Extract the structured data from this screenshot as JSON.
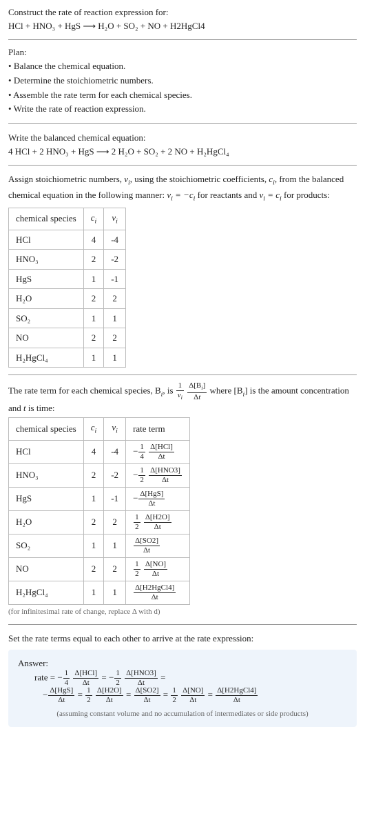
{
  "intro": {
    "line1": "Construct the rate of reaction expression for:",
    "line2": "HCl + HNO₃ + HgS ⟶ H₂O + SO₂ + NO + H2HgCl4"
  },
  "plan": {
    "heading": "Plan:",
    "items": [
      "Balance the chemical equation.",
      "Determine the stoichiometric numbers.",
      "Assemble the rate term for each chemical species.",
      "Write the rate of reaction expression."
    ]
  },
  "balanced": {
    "heading": "Write the balanced chemical equation:",
    "equation": "4 HCl + 2 HNO₃ + HgS ⟶ 2 H₂O + SO₂ + 2 NO + H₂HgCl₄"
  },
  "assign_text_a": "Assign stoichiometric numbers, ",
  "assign_text_b": ", using the stoichiometric coefficients, ",
  "assign_text_c": ", from the balanced chemical equation in the following manner: ",
  "assign_text_d": " for reactants and ",
  "assign_text_e": " for products:",
  "table1": {
    "headers": [
      "chemical species",
      "cᵢ",
      "νᵢ"
    ],
    "rows": [
      [
        "HCl",
        "4",
        "-4"
      ],
      [
        "HNO₃",
        "2",
        "-2"
      ],
      [
        "HgS",
        "1",
        "-1"
      ],
      [
        "H₂O",
        "2",
        "2"
      ],
      [
        "SO₂",
        "1",
        "1"
      ],
      [
        "NO",
        "2",
        "2"
      ],
      [
        "H₂HgCl₄",
        "1",
        "1"
      ]
    ]
  },
  "rate_term_a": "The rate term for each chemical species, B",
  "rate_term_b": ", is ",
  "rate_term_c": " where [B",
  "rate_term_d": "] is the amount concentration and ",
  "rate_term_e": " is time:",
  "table2": {
    "headers": [
      "chemical species",
      "cᵢ",
      "νᵢ",
      "rate term"
    ],
    "rows": [
      {
        "sp": "HCl",
        "c": "4",
        "v": "-4",
        "neg": true,
        "coef_num": "1",
        "coef_den": "4",
        "dnum": "Δ[HCl]",
        "dden": "Δt"
      },
      {
        "sp": "HNO₃",
        "c": "2",
        "v": "-2",
        "neg": true,
        "coef_num": "1",
        "coef_den": "2",
        "dnum": "Δ[HNO3]",
        "dden": "Δt"
      },
      {
        "sp": "HgS",
        "c": "1",
        "v": "-1",
        "neg": true,
        "coef_num": "",
        "coef_den": "",
        "dnum": "Δ[HgS]",
        "dden": "Δt"
      },
      {
        "sp": "H₂O",
        "c": "2",
        "v": "2",
        "neg": false,
        "coef_num": "1",
        "coef_den": "2",
        "dnum": "Δ[H2O]",
        "dden": "Δt"
      },
      {
        "sp": "SO₂",
        "c": "1",
        "v": "1",
        "neg": false,
        "coef_num": "",
        "coef_den": "",
        "dnum": "Δ[SO2]",
        "dden": "Δt"
      },
      {
        "sp": "NO",
        "c": "2",
        "v": "2",
        "neg": false,
        "coef_num": "1",
        "coef_den": "2",
        "dnum": "Δ[NO]",
        "dden": "Δt"
      },
      {
        "sp": "H₂HgCl₄",
        "c": "1",
        "v": "1",
        "neg": false,
        "coef_num": "",
        "coef_den": "",
        "dnum": "Δ[H2HgCl4]",
        "dden": "Δt"
      }
    ]
  },
  "infinitesimal_note": "(for infinitesimal rate of change, replace Δ with d)",
  "final_heading": "Set the rate terms equal to each other to arrive at the rate expression:",
  "answer": {
    "label": "Answer:",
    "rate_prefix": "rate = ",
    "terms": [
      {
        "neg": true,
        "coef_num": "1",
        "coef_den": "4",
        "dnum": "Δ[HCl]",
        "dden": "Δt"
      },
      {
        "neg": true,
        "coef_num": "1",
        "coef_den": "2",
        "dnum": "Δ[HNO3]",
        "dden": "Δt"
      },
      {
        "neg": true,
        "coef_num": "",
        "coef_den": "",
        "dnum": "Δ[HgS]",
        "dden": "Δt"
      },
      {
        "neg": false,
        "coef_num": "1",
        "coef_den": "2",
        "dnum": "Δ[H2O]",
        "dden": "Δt"
      },
      {
        "neg": false,
        "coef_num": "",
        "coef_den": "",
        "dnum": "Δ[SO2]",
        "dden": "Δt"
      },
      {
        "neg": false,
        "coef_num": "1",
        "coef_den": "2",
        "dnum": "Δ[NO]",
        "dden": "Δt"
      },
      {
        "neg": false,
        "coef_num": "",
        "coef_den": "",
        "dnum": "Δ[H2HgCl4]",
        "dden": "Δt"
      }
    ],
    "assumption": "(assuming constant volume and no accumulation of intermediates or side products)"
  }
}
